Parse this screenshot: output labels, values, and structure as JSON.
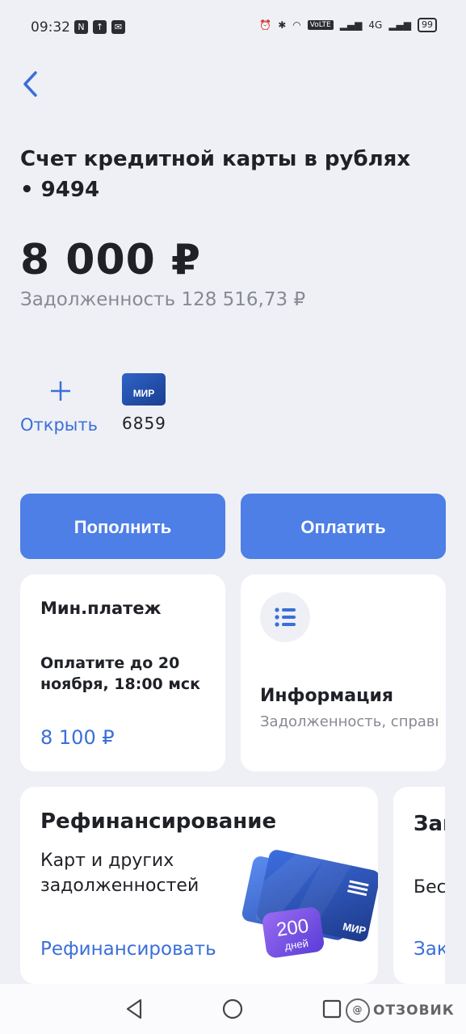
{
  "status_bar": {
    "time": "09:32",
    "battery": "99",
    "network": "4G",
    "volte": "VoLTE"
  },
  "account": {
    "title": "Счет кредитной карты в рублях • 9494",
    "balance": "8 000 ₽",
    "debt": "Задолженность 128 516,73 ₽"
  },
  "card_actions": {
    "open_label": "Открыть",
    "card_brand": "МИР",
    "card_number": "6859"
  },
  "buttons": {
    "top_up": "Пополнить",
    "pay": "Оплатить"
  },
  "min_payment": {
    "title": "Мин.платеж",
    "due_text": "Оплатите до 20 ноября, 18:00 мск",
    "amount": "8 100 ₽"
  },
  "info": {
    "title": "Информация",
    "subtitle": "Задолженность, справки, настрой…"
  },
  "refinance": {
    "title": "Рефинансирование",
    "subtitle": "Карт и других задолженностей",
    "link": "Рефинансировать",
    "promo_days_number": "200",
    "promo_days_unit": "дней",
    "promo_brand": "МИР"
  },
  "next_tile": {
    "title": "Зак пла",
    "subtitle": "Бес",
    "link": "Зак"
  },
  "watermark": {
    "text": "ОТЗОВИК"
  }
}
